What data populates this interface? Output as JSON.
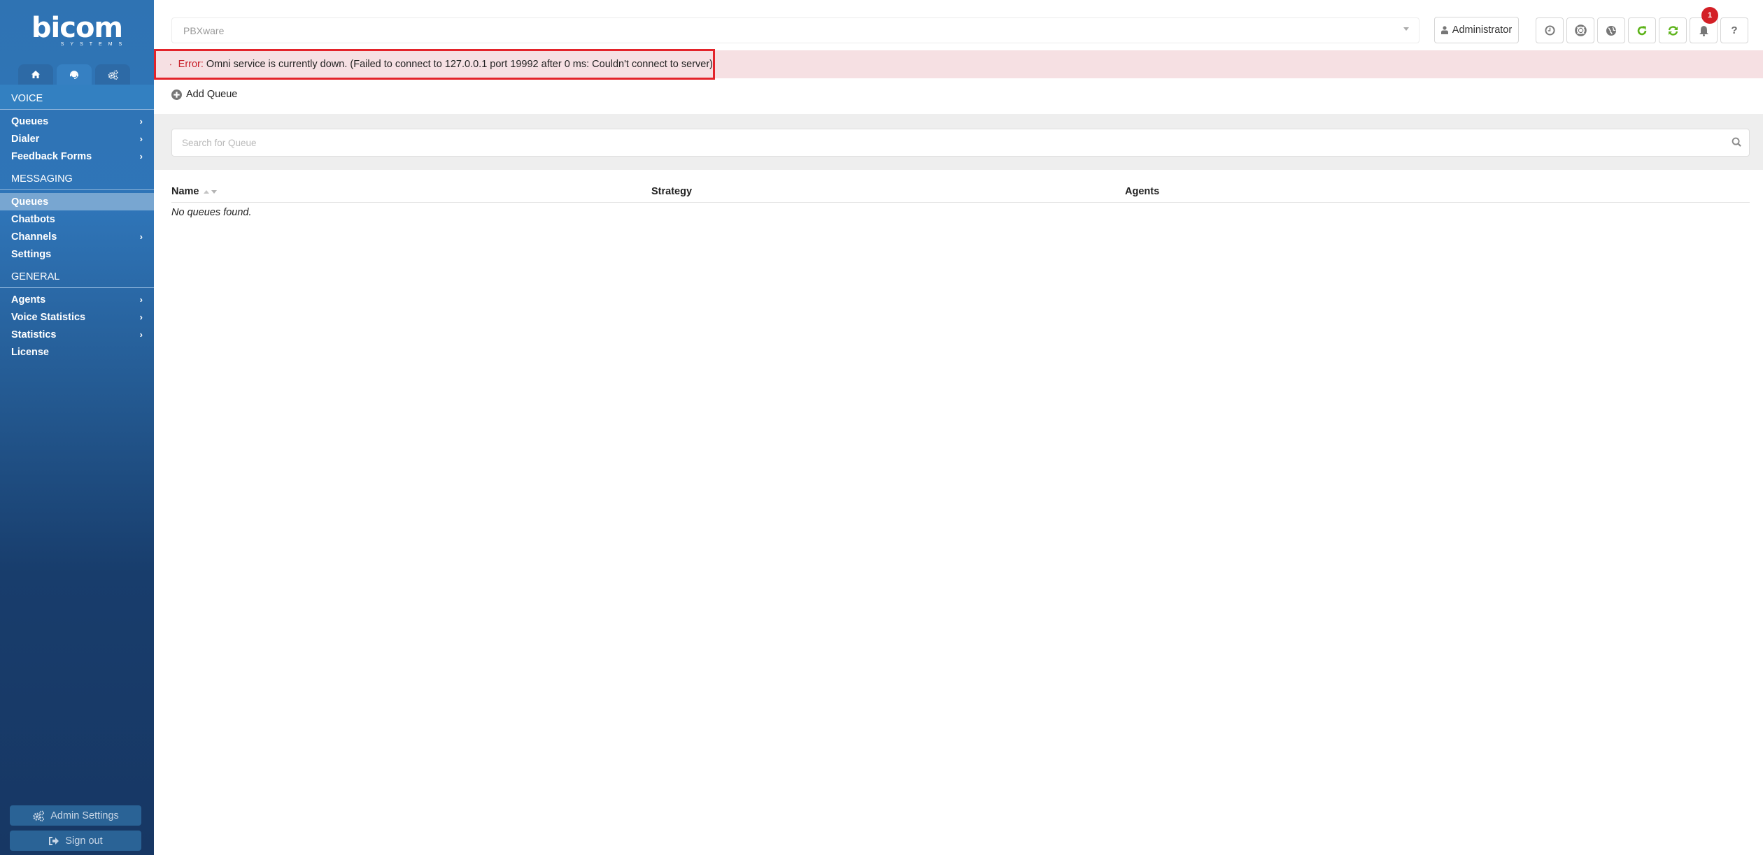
{
  "brand": {
    "logo_text": "bicom",
    "logo_subtext": "SYSTEMS"
  },
  "sidebar": {
    "tabs": [
      {
        "icon": "home-icon",
        "active": false
      },
      {
        "icon": "headset-icon",
        "active": true
      },
      {
        "icon": "gears-icon",
        "active": false
      }
    ],
    "sections": [
      {
        "title": "VOICE",
        "items": [
          {
            "label": "Queues",
            "has_submenu": true
          },
          {
            "label": "Dialer",
            "has_submenu": true
          },
          {
            "label": "Feedback Forms",
            "has_submenu": true
          }
        ]
      },
      {
        "title": "MESSAGING",
        "items": [
          {
            "label": "Queues",
            "has_submenu": false,
            "active": true
          },
          {
            "label": "Chatbots",
            "has_submenu": false
          },
          {
            "label": "Channels",
            "has_submenu": true
          },
          {
            "label": "Settings",
            "has_submenu": false
          }
        ]
      },
      {
        "title": "GENERAL",
        "items": [
          {
            "label": "Agents",
            "has_submenu": true
          },
          {
            "label": "Voice Statistics",
            "has_submenu": true
          },
          {
            "label": "Statistics",
            "has_submenu": true
          },
          {
            "label": "License",
            "has_submenu": false
          }
        ]
      }
    ],
    "admin_settings_label": "Admin Settings",
    "sign_out_label": "Sign out"
  },
  "topbar": {
    "server_select_value": "PBXware",
    "user_label": "Administrator",
    "icon_buttons": [
      "clock-icon",
      "lifebuoy-icon",
      "globe-icon",
      "reload-icon",
      "sync-icon",
      "bell-icon",
      "help-icon"
    ],
    "notification_count": "1",
    "help_label": "?"
  },
  "error": {
    "label": "Error:",
    "message": "Omni service is currently down. (Failed to connect to 127.0.0.1 port 19992 after 0 ms: Couldn't connect to server)"
  },
  "main": {
    "add_queue_label": "Add Queue",
    "search_placeholder": "Search for Queue",
    "search_value": "",
    "table": {
      "columns": [
        "Name",
        "Strategy",
        "Agents"
      ],
      "rows": [],
      "empty_message": "No queues found."
    }
  },
  "colors": {
    "sidebar_top": "#2f73b3",
    "sidebar_bottom": "#173764",
    "error_border": "#e3232a",
    "error_bg": "#f6e0e3",
    "accent_green": "#5db31a",
    "badge_red": "#d31f26"
  }
}
